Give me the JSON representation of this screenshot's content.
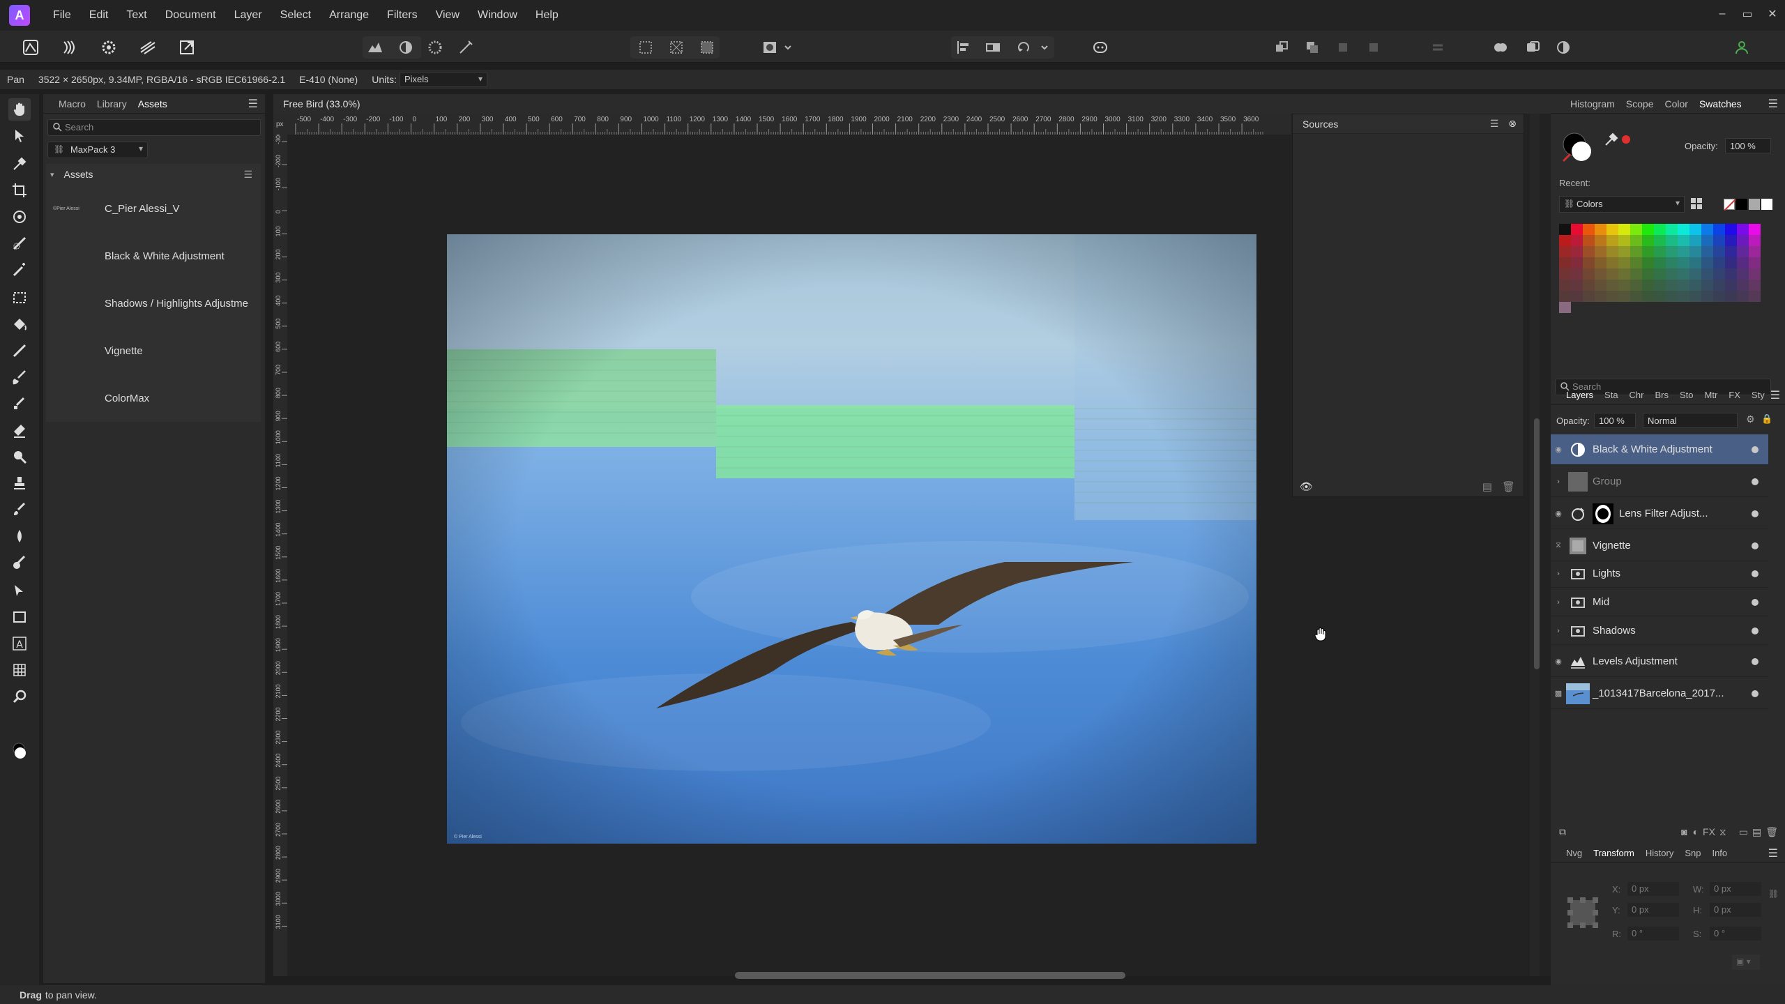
{
  "menu": {
    "items": [
      "File",
      "Edit",
      "Text",
      "Document",
      "Layer",
      "Select",
      "Arrange",
      "Filters",
      "View",
      "Window",
      "Help"
    ]
  },
  "window_controls": {
    "minimize": "–",
    "maximize": "▭",
    "close": "✕"
  },
  "context": {
    "tool": "Pan",
    "doc_info": "3522 × 2650px, 9.34MP, RGBA/16 - sRGB IEC61966-2.1",
    "camera": "E-410 (None)",
    "units_label": "Units:",
    "units_value": "Pixels"
  },
  "assets_panel": {
    "tabs": [
      "Macro",
      "Library",
      "Assets"
    ],
    "search_placeholder": "Search",
    "pack": "MaxPack 3",
    "section_title": "Assets",
    "items": [
      {
        "label": "C_Pier Alessi_V",
        "thumb": "©Pier Alessi"
      },
      {
        "label": "Black & White Adjustment"
      },
      {
        "label": "Shadows / Highlights Adjustme"
      },
      {
        "label": "Vignette"
      },
      {
        "label": "ColorMax"
      }
    ]
  },
  "document": {
    "title": "Free Bird (33.0%)",
    "ruler_unit": "px",
    "h_ticks": [
      "-500",
      "-400",
      "-300",
      "-200",
      "-100",
      "0",
      "100",
      "200",
      "300",
      "400",
      "500",
      "600",
      "700",
      "800",
      "900",
      "1000",
      "1100",
      "1200",
      "1300",
      "1400",
      "1500",
      "1600",
      "1700",
      "1800",
      "1900",
      "2000",
      "2100",
      "2200",
      "2300",
      "2400",
      "2500",
      "2600",
      "2700",
      "2800",
      "2900",
      "3000",
      "3100",
      "3200",
      "3300",
      "3400",
      "3500",
      "3600"
    ],
    "v_ticks": [
      "-300",
      "-200",
      "-100",
      "0",
      "100",
      "200",
      "300",
      "400",
      "500",
      "600",
      "700",
      "800",
      "900",
      "1000",
      "1100",
      "1200",
      "1300",
      "1400",
      "1500",
      "1600",
      "1700",
      "1800",
      "1900",
      "2000",
      "2100",
      "2200",
      "2300",
      "2400",
      "2500",
      "2600",
      "2700",
      "2800",
      "2900",
      "3000",
      "3100"
    ],
    "watermark": "© Pier Alessi"
  },
  "sources_panel": {
    "title": "Sources"
  },
  "right_panel": {
    "tabs": [
      "Histogram",
      "Scope",
      "Color",
      "Swatches"
    ],
    "opacity_label": "Opacity:",
    "opacity_value": "100 %",
    "recent_label": "Recent:",
    "palette": "Colors",
    "search_placeholder": "Search",
    "layer_tabs": [
      "Layers",
      "Sta",
      "Chr",
      "Brs",
      "Sto",
      "Mtr",
      "FX",
      "Sty"
    ],
    "layers_opacity_label": "Opacity:",
    "layers_opacity": "100 %",
    "blend_mode": "Normal",
    "layers": [
      {
        "name": "Black & White Adjustment",
        "selected": true,
        "kind": "bw"
      },
      {
        "name": "Group",
        "dim": true,
        "kind": "group"
      },
      {
        "name": "Lens Filter Adjust...",
        "kind": "lens"
      },
      {
        "name": "Vignette",
        "kind": "vignette"
      },
      {
        "name": "Lights",
        "kind": "folder"
      },
      {
        "name": "Mid",
        "kind": "folder"
      },
      {
        "name": "Shadows",
        "kind": "folder"
      },
      {
        "name": "Levels Adjustment",
        "kind": "levels"
      },
      {
        "name": "_1013417Barcelona_2017...",
        "kind": "image"
      }
    ],
    "bottom_tabs": [
      "Nvg",
      "Transform",
      "History",
      "Snp",
      "Info"
    ],
    "transform": {
      "x_label": "X:",
      "x": "0 px",
      "y_label": "Y:",
      "y": "0 px",
      "w_label": "W:",
      "w": "0 px",
      "h_label": "H:",
      "h": "0 px",
      "r_label": "R:",
      "r": "0 °",
      "s_label": "S:",
      "s": "0 °"
    }
  },
  "status": {
    "bold": "Drag",
    "text": "to pan view."
  },
  "colors": {
    "selection": "#4a5f86",
    "accent_red": "#e03030",
    "sky_top": "#8cb4d9",
    "sky_bottom": "#3d79c9"
  }
}
